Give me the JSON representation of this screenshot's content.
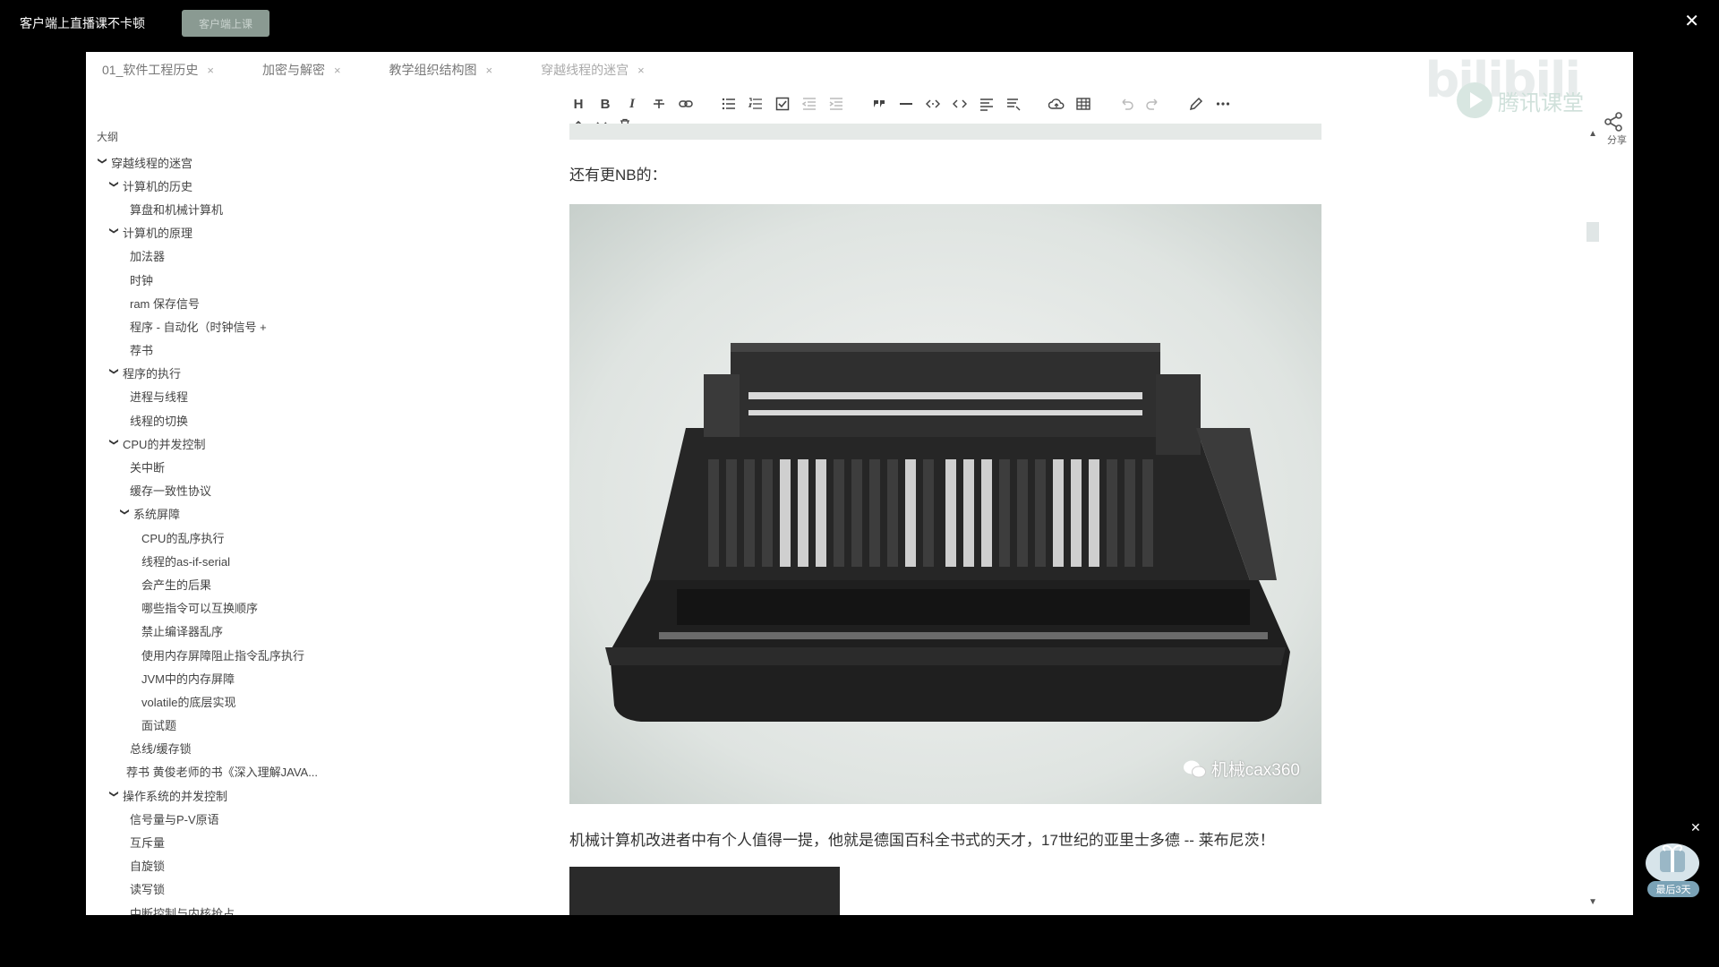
{
  "topbar": {
    "title": "客户端上直播课不卡顿",
    "button_label": "客户端上课",
    "close_icon": "close-icon"
  },
  "tabs": [
    {
      "label": "01_软件工程历史"
    },
    {
      "label": "加密与解密"
    },
    {
      "label": "教学组织结构图"
    },
    {
      "label": "穿越线程的迷宫"
    }
  ],
  "watermark": {
    "bilibili": "bilibili",
    "tengxun": "腾讯课堂"
  },
  "share": {
    "label": "分享"
  },
  "sidebar": {
    "title": "大纲",
    "items": [
      {
        "label": "穿越线程的迷宫"
      },
      {
        "label": "计算机的历史"
      },
      {
        "label": "算盘和机械计算机"
      },
      {
        "label": "计算机的原理"
      },
      {
        "label": "加法器"
      },
      {
        "label": "时钟"
      },
      {
        "label": "ram 保存信号"
      },
      {
        "label": "程序 - 自动化（时钟信号 +"
      },
      {
        "label": "荐书"
      },
      {
        "label": "程序的执行"
      },
      {
        "label": "进程与线程"
      },
      {
        "label": "线程的切换"
      },
      {
        "label": "CPU的并发控制"
      },
      {
        "label": "关中断"
      },
      {
        "label": "缓存一致性协议"
      },
      {
        "label": "系统屏障"
      },
      {
        "label": "CPU的乱序执行"
      },
      {
        "label": "线程的as-if-serial"
      },
      {
        "label": "会产生的后果"
      },
      {
        "label": "哪些指令可以互换顺序"
      },
      {
        "label": "禁止编译器乱序"
      },
      {
        "label": "使用内存屏障阻止指令乱序执行"
      },
      {
        "label": "JVM中的内存屏障"
      },
      {
        "label": "volatile的底层实现"
      },
      {
        "label": "面试题"
      },
      {
        "label": "总线/缓存锁"
      },
      {
        "label": "荐书 黄俊老师的书《深入理解JAVA..."
      },
      {
        "label": "操作系统的并发控制"
      },
      {
        "label": "信号量与P-V原语"
      },
      {
        "label": "互斥量"
      },
      {
        "label": "自旋锁"
      },
      {
        "label": "读写锁"
      },
      {
        "label": "中断控制与内核抢占"
      }
    ]
  },
  "toolbar": {
    "heading": "H",
    "bold": "B",
    "italic": "I"
  },
  "content": {
    "para1": "还有更NB的：",
    "image_watermark": "机械cax360",
    "para2": "机械计算机改进者中有个人值得一提，他就是德国百科全书式的天才，17世纪的亚里士多德 -- 莱布尼茨！"
  },
  "float_widget": {
    "badge": "最后3天"
  }
}
